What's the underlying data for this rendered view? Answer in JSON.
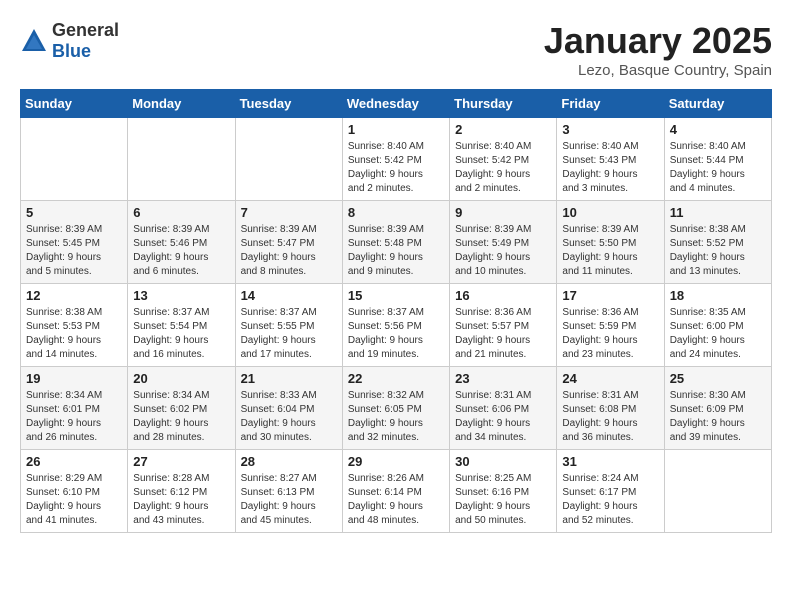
{
  "header": {
    "logo_general": "General",
    "logo_blue": "Blue",
    "month_title": "January 2025",
    "location": "Lezo, Basque Country, Spain"
  },
  "weekdays": [
    "Sunday",
    "Monday",
    "Tuesday",
    "Wednesday",
    "Thursday",
    "Friday",
    "Saturday"
  ],
  "weeks": [
    [
      {
        "day": "",
        "info": ""
      },
      {
        "day": "",
        "info": ""
      },
      {
        "day": "",
        "info": ""
      },
      {
        "day": "1",
        "info": "Sunrise: 8:40 AM\nSunset: 5:42 PM\nDaylight: 9 hours\nand 2 minutes."
      },
      {
        "day": "2",
        "info": "Sunrise: 8:40 AM\nSunset: 5:42 PM\nDaylight: 9 hours\nand 2 minutes."
      },
      {
        "day": "3",
        "info": "Sunrise: 8:40 AM\nSunset: 5:43 PM\nDaylight: 9 hours\nand 3 minutes."
      },
      {
        "day": "4",
        "info": "Sunrise: 8:40 AM\nSunset: 5:44 PM\nDaylight: 9 hours\nand 4 minutes."
      }
    ],
    [
      {
        "day": "5",
        "info": "Sunrise: 8:39 AM\nSunset: 5:45 PM\nDaylight: 9 hours\nand 5 minutes."
      },
      {
        "day": "6",
        "info": "Sunrise: 8:39 AM\nSunset: 5:46 PM\nDaylight: 9 hours\nand 6 minutes."
      },
      {
        "day": "7",
        "info": "Sunrise: 8:39 AM\nSunset: 5:47 PM\nDaylight: 9 hours\nand 8 minutes."
      },
      {
        "day": "8",
        "info": "Sunrise: 8:39 AM\nSunset: 5:48 PM\nDaylight: 9 hours\nand 9 minutes."
      },
      {
        "day": "9",
        "info": "Sunrise: 8:39 AM\nSunset: 5:49 PM\nDaylight: 9 hours\nand 10 minutes."
      },
      {
        "day": "10",
        "info": "Sunrise: 8:39 AM\nSunset: 5:50 PM\nDaylight: 9 hours\nand 11 minutes."
      },
      {
        "day": "11",
        "info": "Sunrise: 8:38 AM\nSunset: 5:52 PM\nDaylight: 9 hours\nand 13 minutes."
      }
    ],
    [
      {
        "day": "12",
        "info": "Sunrise: 8:38 AM\nSunset: 5:53 PM\nDaylight: 9 hours\nand 14 minutes."
      },
      {
        "day": "13",
        "info": "Sunrise: 8:37 AM\nSunset: 5:54 PM\nDaylight: 9 hours\nand 16 minutes."
      },
      {
        "day": "14",
        "info": "Sunrise: 8:37 AM\nSunset: 5:55 PM\nDaylight: 9 hours\nand 17 minutes."
      },
      {
        "day": "15",
        "info": "Sunrise: 8:37 AM\nSunset: 5:56 PM\nDaylight: 9 hours\nand 19 minutes."
      },
      {
        "day": "16",
        "info": "Sunrise: 8:36 AM\nSunset: 5:57 PM\nDaylight: 9 hours\nand 21 minutes."
      },
      {
        "day": "17",
        "info": "Sunrise: 8:36 AM\nSunset: 5:59 PM\nDaylight: 9 hours\nand 23 minutes."
      },
      {
        "day": "18",
        "info": "Sunrise: 8:35 AM\nSunset: 6:00 PM\nDaylight: 9 hours\nand 24 minutes."
      }
    ],
    [
      {
        "day": "19",
        "info": "Sunrise: 8:34 AM\nSunset: 6:01 PM\nDaylight: 9 hours\nand 26 minutes."
      },
      {
        "day": "20",
        "info": "Sunrise: 8:34 AM\nSunset: 6:02 PM\nDaylight: 9 hours\nand 28 minutes."
      },
      {
        "day": "21",
        "info": "Sunrise: 8:33 AM\nSunset: 6:04 PM\nDaylight: 9 hours\nand 30 minutes."
      },
      {
        "day": "22",
        "info": "Sunrise: 8:32 AM\nSunset: 6:05 PM\nDaylight: 9 hours\nand 32 minutes."
      },
      {
        "day": "23",
        "info": "Sunrise: 8:31 AM\nSunset: 6:06 PM\nDaylight: 9 hours\nand 34 minutes."
      },
      {
        "day": "24",
        "info": "Sunrise: 8:31 AM\nSunset: 6:08 PM\nDaylight: 9 hours\nand 36 minutes."
      },
      {
        "day": "25",
        "info": "Sunrise: 8:30 AM\nSunset: 6:09 PM\nDaylight: 9 hours\nand 39 minutes."
      }
    ],
    [
      {
        "day": "26",
        "info": "Sunrise: 8:29 AM\nSunset: 6:10 PM\nDaylight: 9 hours\nand 41 minutes."
      },
      {
        "day": "27",
        "info": "Sunrise: 8:28 AM\nSunset: 6:12 PM\nDaylight: 9 hours\nand 43 minutes."
      },
      {
        "day": "28",
        "info": "Sunrise: 8:27 AM\nSunset: 6:13 PM\nDaylight: 9 hours\nand 45 minutes."
      },
      {
        "day": "29",
        "info": "Sunrise: 8:26 AM\nSunset: 6:14 PM\nDaylight: 9 hours\nand 48 minutes."
      },
      {
        "day": "30",
        "info": "Sunrise: 8:25 AM\nSunset: 6:16 PM\nDaylight: 9 hours\nand 50 minutes."
      },
      {
        "day": "31",
        "info": "Sunrise: 8:24 AM\nSunset: 6:17 PM\nDaylight: 9 hours\nand 52 minutes."
      },
      {
        "day": "",
        "info": ""
      }
    ]
  ]
}
